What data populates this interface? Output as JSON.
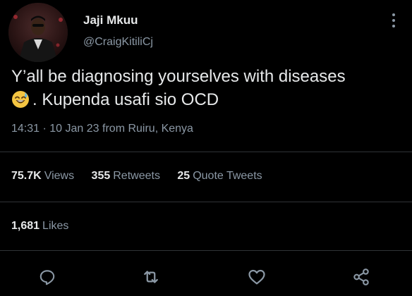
{
  "author": {
    "name": "Jaji Mkuu",
    "handle": "@CraigKitiliCj"
  },
  "tweet": {
    "text": ". Kupenda usafi sio OCD",
    "text_line1": "Y’all be diagnosing yourselves with diseases",
    "emoji": "sweat-smile-emoji",
    "time": "14:31",
    "separator": "·",
    "date": "10 Jan 23",
    "location": "from Ruiru, Kenya"
  },
  "stats": {
    "views": {
      "value": "75.7K",
      "label": "Views"
    },
    "retweets": {
      "value": "355",
      "label": "Retweets"
    },
    "quote_tweets": {
      "value": "25",
      "label": "Quote Tweets"
    },
    "likes": {
      "value": "1,681",
      "label": "Likes"
    }
  },
  "actions": [
    "reply-icon",
    "retweet-icon",
    "like-icon",
    "share-icon"
  ],
  "colors": {
    "background": "#000000",
    "text": "#e7e9ea",
    "muted": "#8b98a5",
    "divider": "#2f3336"
  }
}
